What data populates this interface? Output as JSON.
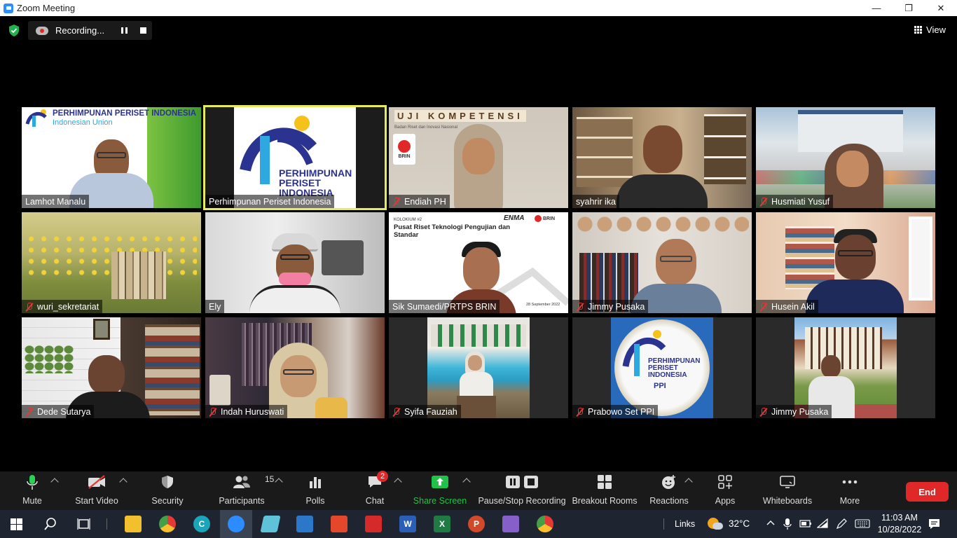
{
  "window": {
    "title": "Zoom Meeting",
    "minimize": "—",
    "maximize": "❐",
    "close": "✕"
  },
  "topbar": {
    "recording_label": "Recording...",
    "view_label": "View"
  },
  "tiles": [
    {
      "name": "Lamhot Manalu",
      "muted": false,
      "banner_line1": "PERHIMPUNAN PERISET INDONESIA",
      "banner_line2": "Indonesian  Union"
    },
    {
      "name": "Perhimpunan Periset Indonesia",
      "muted": false,
      "logo_text": "PERHIMPUNAN PERISET INDONESIA"
    },
    {
      "name": "Endiah PH",
      "muted": true,
      "sign": "UJI KOMPETENSI",
      "org": "Badan Riset dan Inovasi Nasional",
      "brand": "BRIN"
    },
    {
      "name": "syahrir ika",
      "muted": false
    },
    {
      "name": "Husmiati Yusuf",
      "muted": true
    },
    {
      "name": "wuri_sekretariat",
      "muted": true
    },
    {
      "name": "Ely",
      "muted": false
    },
    {
      "name": "Sik Sumaedi/PRTPS BRIN",
      "muted": false,
      "slide_small": "KOLOKIUM #2",
      "slide_title": "Pusat Riset Teknologi Pengujian dan Standar",
      "slide_brand": "BRIN",
      "slide_tag": "ENMA",
      "slide_date": "28 September 2022"
    },
    {
      "name": "Jimmy Pusaka",
      "muted": true
    },
    {
      "name": "Husein Akil",
      "muted": true
    },
    {
      "name": "Dede Sutarya",
      "muted": true
    },
    {
      "name": "Indah Huruswati",
      "muted": true
    },
    {
      "name": "Syifa Fauziah",
      "muted": true
    },
    {
      "name": "Prabowo Set PPI",
      "muted": true,
      "logo_text": "PERHIMPUNAN PERISET INDONESIA",
      "sub": "PPI"
    },
    {
      "name": "Jimmy Pusaka",
      "muted": true
    }
  ],
  "toolbar": {
    "mute": "Mute",
    "start_video": "Start Video",
    "security": "Security",
    "participants": "Participants",
    "participants_count": "15",
    "polls": "Polls",
    "chat": "Chat",
    "chat_badge": "2",
    "share_screen": "Share Screen",
    "pause_stop_recording": "Pause/Stop Recording",
    "breakout_rooms": "Breakout Rooms",
    "reactions": "Reactions",
    "apps": "Apps",
    "whiteboards": "Whiteboards",
    "more": "More",
    "end": "End"
  },
  "taskbar": {
    "links": "Links",
    "temperature": "32°C",
    "time": "11:03 AM",
    "date": "10/28/2022"
  },
  "colors": {
    "accent": "#2d8cff",
    "active_speaker": "#e6eb5b",
    "end": "#e02828",
    "share": "#22c24a",
    "ppi_blue": "#2b3391"
  }
}
